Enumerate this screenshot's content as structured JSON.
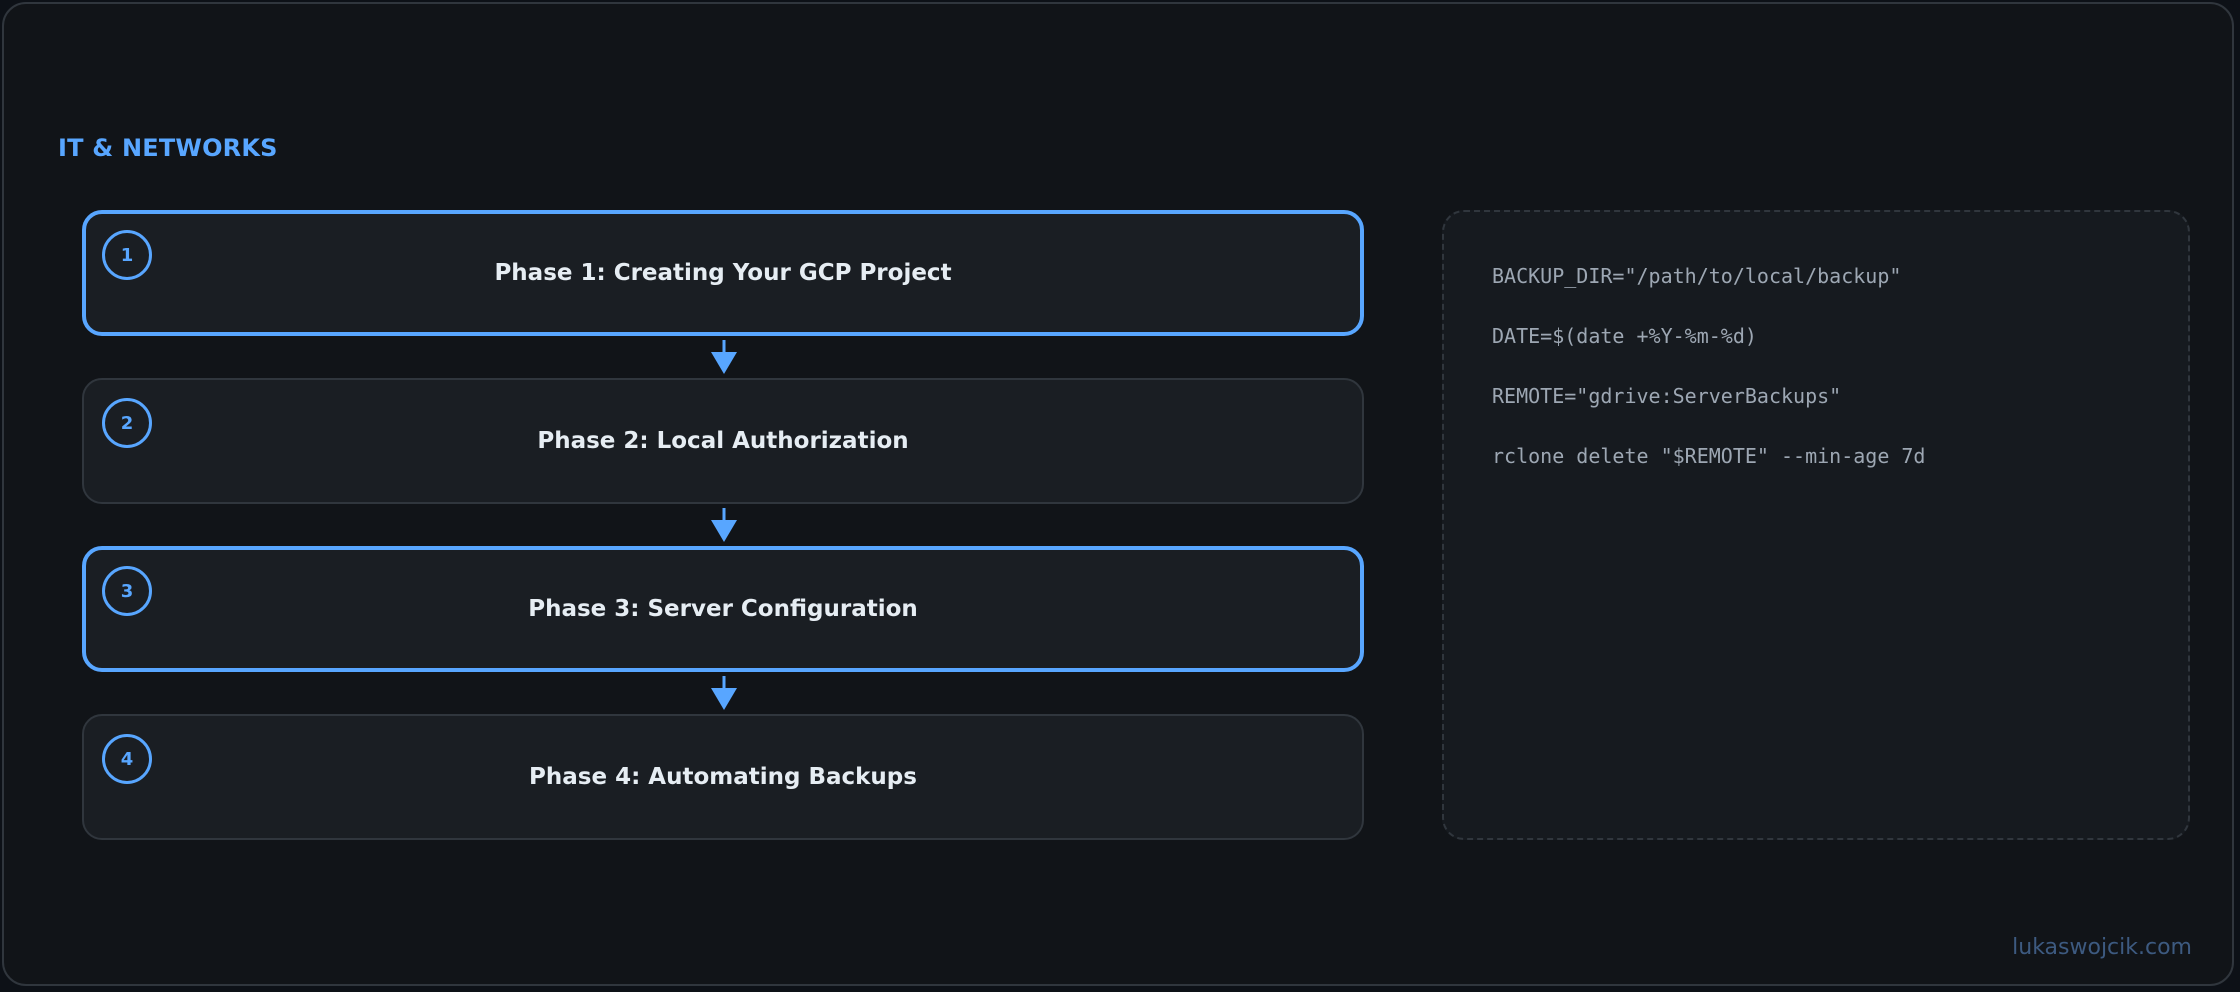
{
  "section_title": "IT & NETWORKS",
  "accent_color": "#58a6ff",
  "phases": [
    {
      "number": "1",
      "label": "Phase 1: Creating Your GCP Project",
      "highlighted": true
    },
    {
      "number": "2",
      "label": "Phase 2: Local Authorization",
      "highlighted": false
    },
    {
      "number": "3",
      "label": "Phase 3: Server Configuration",
      "highlighted": true
    },
    {
      "number": "4",
      "label": "Phase 4: Automating Backups",
      "highlighted": false
    }
  ],
  "code_lines": [
    "BACKUP_DIR=\"/path/to/local/backup\"",
    "DATE=$(date +%Y-%m-%d)",
    "REMOTE=\"gdrive:ServerBackups\"",
    "rclone delete \"$REMOTE\" --min-age 7d"
  ],
  "watermark": "lukaswojcik.com",
  "arrow_icons": [
    "arrow-down-icon",
    "arrow-down-icon",
    "arrow-down-icon"
  ]
}
